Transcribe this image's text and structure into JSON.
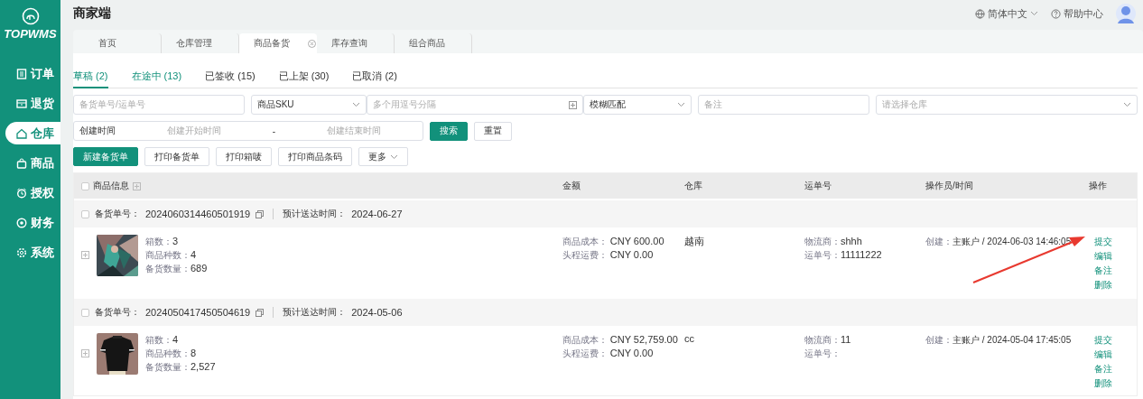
{
  "logo": {
    "text": "TOPWMS"
  },
  "sidebar": {
    "items": [
      {
        "label": "订单",
        "selected": false
      },
      {
        "label": "退货",
        "selected": false
      },
      {
        "label": "仓库",
        "selected": true
      },
      {
        "label": "商品",
        "selected": false
      },
      {
        "label": "授权",
        "selected": false
      },
      {
        "label": "财务",
        "selected": false
      },
      {
        "label": "系统",
        "selected": false
      }
    ]
  },
  "header": {
    "title": "商家端",
    "language": "简体中文",
    "help": "帮助中心"
  },
  "page_tabs": [
    {
      "label": "首页",
      "selected": false,
      "closable": false
    },
    {
      "label": "仓库管理",
      "selected": false,
      "closable": false
    },
    {
      "label": "商品备货",
      "selected": true,
      "closable": true
    },
    {
      "label": "库存查询",
      "selected": false,
      "closable": false
    },
    {
      "label": "组合商品",
      "selected": false,
      "closable": false
    }
  ],
  "status_tabs": [
    {
      "label": "草稿 (2)",
      "selected": true,
      "hovered": false
    },
    {
      "label": "在途中 (13)",
      "selected": false,
      "hovered": true
    },
    {
      "label": "已签收 (15)",
      "selected": false,
      "hovered": false
    },
    {
      "label": "已上架 (30)",
      "selected": false,
      "hovered": false
    },
    {
      "label": "已取消 (2)",
      "selected": false,
      "hovered": false
    }
  ],
  "filters": {
    "order_no": {
      "placeholder": "备货单号/运单号"
    },
    "sku_type": {
      "value": "商品SKU"
    },
    "sku": {
      "placeholder": "多个用逗号分隔"
    },
    "match": {
      "value": "模糊匹配"
    },
    "remark": {
      "placeholder": "备注"
    },
    "warehouse": {
      "placeholder": "请选择仓库"
    },
    "date": {
      "label": "创建时间",
      "start_placeholder": "创建开始时间",
      "separator": "-",
      "end_placeholder": "创建结束时间"
    },
    "buttons": [
      {
        "label": "搜索",
        "kind": "primary"
      },
      {
        "label": "重置",
        "kind": "default"
      }
    ]
  },
  "actions": [
    {
      "label": "新建备货单",
      "kind": "primary"
    },
    {
      "label": "打印备货单",
      "kind": "default"
    },
    {
      "label": "打印箱唛",
      "kind": "default"
    },
    {
      "label": "打印商品条码",
      "kind": "default"
    },
    {
      "label": "更多",
      "kind": "dropdown"
    }
  ],
  "table": {
    "select_all": {
      "checked": false
    },
    "columns": [
      "商品信息",
      "金额",
      "仓库",
      "运单号",
      "操作员/时间",
      "操作"
    ],
    "orders": [
      {
        "checked": false,
        "order_label": "备货单号：",
        "order_no": "2024060314460501919",
        "eta_label": "预计送达时间：",
        "eta": "2024-06-27",
        "image": {
          "kind": "picture"
        },
        "info": [
          {
            "label": "箱数：",
            "value": "3"
          },
          {
            "label": "商品种数：",
            "value": "4"
          },
          {
            "label": "备货数量：",
            "value": "689"
          }
        ],
        "amount": [
          {
            "label": "商品成本：",
            "value": "CNY 600.00"
          },
          {
            "label": "头程运费：",
            "value": "CNY 0.00"
          }
        ],
        "warehouse": "越南",
        "shipping": [
          {
            "label": "物流商：",
            "value": "shhh"
          },
          {
            "label": "运单号：",
            "value": "11111222"
          }
        ],
        "operator": {
          "label": "创建：",
          "value": "主账户 / 2024-06-03 14:46:05"
        },
        "operations": [
          "提交",
          "编辑",
          "备注",
          "删除"
        ]
      },
      {
        "checked": false,
        "order_label": "备货单号：",
        "order_no": "2024050417450504619",
        "eta_label": "预计送达时间：",
        "eta": "2024-05-06",
        "image": {
          "kind": "picture"
        },
        "info": [
          {
            "label": "箱数：",
            "value": "4"
          },
          {
            "label": "商品种数：",
            "value": "8"
          },
          {
            "label": "备货数量：",
            "value": "2,527"
          }
        ],
        "amount": [
          {
            "label": "商品成本：",
            "value": "CNY 52,759.00"
          },
          {
            "label": "头程运费：",
            "value": "CNY 0.00"
          }
        ],
        "warehouse": "cc",
        "shipping": [
          {
            "label": "物流商：",
            "value": "11"
          },
          {
            "label": "运单号："
          }
        ],
        "operator": {
          "label": "创建：",
          "value": "主账户 / 2024-05-04 17:45:05"
        },
        "operations": [
          "提交",
          "编辑",
          "备注",
          "删除"
        ]
      }
    ]
  }
}
